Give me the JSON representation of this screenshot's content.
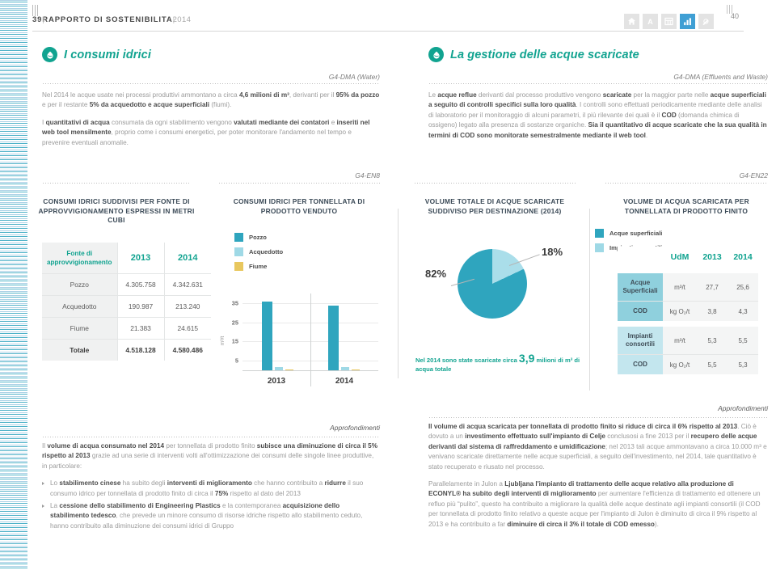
{
  "header": {
    "page_number_left": "39",
    "title": "RAPPORTO DI SOSTENIBILITA",
    "separator": "|",
    "year": "2014",
    "page_number_right": "40",
    "icons": [
      {
        "name": "home-icon",
        "active": false
      },
      {
        "name": "text-icon",
        "active": false
      },
      {
        "name": "table-icon",
        "active": false
      },
      {
        "name": "bar-chart-icon",
        "active": true
      },
      {
        "name": "edit-icon",
        "active": false
      }
    ],
    "active_color": "#3f9fd4"
  },
  "left_section": {
    "icon_name": "water-drop-icon",
    "heading": "I consumi idrici",
    "g4_tag": "G4-DMA (Water)",
    "paragraphs": [
      "Nel 2014 le acque usate nei processi produttivi ammontano a circa <b>4,6 milioni di m³</b>, derivanti per il <b>95% da pozzo</b> e per il restante <b>5% da acquedotto e acque superficiali</b> (fiumi).",
      "I <b>quantitativi di acqua</b> consumata da ogni stabilimento vengono <b>valutati mediante dei contatori</b> e <b>inseriti nel web tool mensilmente</b>, proprio come i consumi energetici, per poter monitorare l'andamento nel tempo e prevenire eventuali anomalie."
    ]
  },
  "right_section": {
    "icon_name": "water-drop-icon",
    "heading": "La gestione delle acque scaricate",
    "g4_tag": "G4-DMA (Effluents and Waste)",
    "paragraphs": [
      "Le <b>acque reflue</b> derivanti dal processo produttivo vengono <b>scaricate</b> per la maggior parte nelle <b>acque superficiali a seguito di controlli specifici sulla loro qualità</b>. I controlli sono effettuati periodicamente mediante delle analisi di laboratorio per il monitoraggio di alcuni parametri, il più rilevante dei quali è il <b>COD</b> (domanda chimica di ossigeno) legato alla presenza di sostanze organiche. <b>Sia il quantitativo di acque scaricate che la sua qualità in termini di COD sono monitorate semestralmente mediante il web tool</b>."
    ]
  },
  "g4_mid_left": "G4-EN8",
  "g4_mid_right": "G4-EN22",
  "fig1": {
    "title": "CONSUMI IDRICI SUDDIVISI PER FONTE DI APPROVVIGIONAMENTO ESPRESSI IN METRI CUBI",
    "table": {
      "header_label": "Fonte di approvvigionamento",
      "columns": [
        "2013",
        "2014"
      ],
      "rows": [
        {
          "label": "Pozzo",
          "values": [
            "4.305.758",
            "4.342.631"
          ]
        },
        {
          "label": "Acquedotto",
          "values": [
            "190.987",
            "213.240"
          ]
        },
        {
          "label": "Fiume",
          "values": [
            "21.383",
            "24.615"
          ]
        }
      ],
      "total": {
        "label": "Totale",
        "values": [
          "4.518.128",
          "4.580.486"
        ]
      }
    }
  },
  "fig2": {
    "title": "CONSUMI IDRICI PER TONNELLATA DI PRODOTTO VENDUTO"
  },
  "fig3": {
    "title": "VOLUME TOTALE DI ACQUE SCARICATE SUDDIVISO PER DESTINAZIONE (2014)",
    "note_prefix": "Nel 2014 sono state scaricate circa",
    "note_big": "3,9",
    "note_suffix": "milioni di m³ di acqua totale"
  },
  "fig4": {
    "title": "VOLUME DI ACQUA SCARICATA PER TONNELLATA DI PRODOTTO FINITO",
    "legend": [
      {
        "label": "Acque superficiali",
        "color": "#2fa5be"
      },
      {
        "label": "Impianti consortili",
        "color": "#9fd9e6"
      }
    ],
    "table": {
      "columns": [
        "UdM",
        "2013",
        "2014"
      ],
      "groups": [
        {
          "name": "Acque Superficiali",
          "shade": "dark",
          "rows": [
            {
              "label": "Acque Superficiali",
              "unit": "m³/t",
              "v2013": "27,7",
              "v2014": "25,6"
            },
            {
              "label": "COD",
              "unit": "kg O₂/t",
              "v2013": "3,8",
              "v2014": "4,3"
            }
          ]
        },
        {
          "name": "Impianti consortili",
          "shade": "light",
          "rows": [
            {
              "label": "Impianti consortili",
              "unit": "m³/t",
              "v2013": "5,3",
              "v2014": "5,5"
            },
            {
              "label": "COD",
              "unit": "kg O₂/t",
              "v2013": "5,5",
              "v2014": "5,3"
            }
          ]
        }
      ]
    }
  },
  "approfondimenti_label": "Approfondimenti",
  "bottom_left": {
    "intro": "Il <b>volume di acqua consumato nel 2014</b> per tonnellata di prodotto finito <b>subisce una diminuzione di circa il 5% rispetto al 2013</b> grazie ad una serie di interventi volti all'ottimizzazione dei consumi delle singole linee produttive, in particolare:",
    "bullets": [
      "Lo <b>stabilimento cinese</b> ha subito degli <b>interventi di miglioramento</b> che hanno contribuito a <b>ridurre</b> il suo consumo idrico per tonnellata di prodotto finito di circa il <b>75%</b> rispetto al dato del 2013",
      "La <b>cessione dello stabilimento di Engineering Plastics</b> e la contemporanea <b>acquisizione dello stabilimento tedesco</b>, che prevede un minore consumo di risorse idriche rispetto allo stabilimento ceduto, hanno contribuito alla diminuzione dei consumi idrici di Gruppo"
    ]
  },
  "bottom_right": {
    "paragraphs": [
      "<b>Il volume di acqua scaricata per tonnellata di prodotto finito si riduce di circa il 6% rispetto al 2013</b>. Ciò è dovuto a un <b>investimento effettuato sull'impianto di Celje</b> conclusosi a fine 2013 per il <b>recupero delle acque derivanti dal sistema di raffreddamento e umidificazione</b>; nel 2013 tali acque ammontavano a circa 10.000 m³ e venivano scaricate direttamente nelle acque superficiali, a seguito dell'investimento, nel 2014, tale quantitativo è stato recuperato e riusato nel processo.",
      "Parallelamente in Julon a <b>Ljubljana l'impianto di trattamento delle acque relativo alla produzione di ECONYL® ha subito degli interventi di miglioramento</b> per aumentare l'efficienza di trattamento ed ottenere un refluo più “pulito”, questo ha contribuito a migliorare la qualità delle acque destinate agli impianti consortili (il COD per tonnellata di prodotto finito relativo a queste acque per l'impianto di Julon è diminuito di circa il 9% rispetto al 2013 e ha contribuito a far <b>diminuire di circa il 3% il totale di COD emesso</b>)."
    ]
  },
  "chart_data": [
    {
      "type": "bar",
      "title": "CONSUMI IDRICI PER TONNELLATA DI PRODOTTO VENDUTO",
      "categories": [
        "2013",
        "2014"
      ],
      "series": [
        {
          "name": "Pozzo",
          "color": "#2fa5be",
          "values": [
            36.0,
            33.5
          ]
        },
        {
          "name": "Acquedotto",
          "color": "#9fd9e6",
          "values": [
            1.6,
            1.8
          ]
        },
        {
          "name": "Fiume",
          "color": "#e8c75e",
          "values": [
            0.5,
            0.5
          ]
        }
      ],
      "ylabel": "m³/t",
      "yticks": [
        5,
        15,
        25,
        35
      ],
      "ylim": [
        0,
        40
      ],
      "grid": true,
      "legend_position": "top-left"
    },
    {
      "type": "pie",
      "title": "VOLUME TOTALE DI ACQUE SCARICATE SUDDIVISO PER DESTINAZIONE (2014)",
      "labels": [
        "Acque superficiali",
        "Impianti consortili"
      ],
      "values": [
        82,
        18
      ],
      "value_labels": [
        "82%",
        "18%"
      ],
      "colors": [
        "#2fa5be",
        "#aadeea"
      ],
      "legend_position": "right"
    },
    {
      "type": "table",
      "title": "VOLUME DI ACQUA SCARICATA PER TONNELLATA DI PRODOTTO FINITO",
      "columns": [
        "",
        "UdM",
        "2013",
        "2014"
      ],
      "rows": [
        [
          "Acque Superficiali",
          "m³/t",
          "27,7",
          "25,6"
        ],
        [
          "COD",
          "kg O₂/t",
          "3,8",
          "4,3"
        ],
        [
          "Impianti consortili",
          "m³/t",
          "5,3",
          "5,5"
        ],
        [
          "COD",
          "kg O₂/t",
          "5,5",
          "5,3"
        ]
      ]
    },
    {
      "type": "table",
      "title": "CONSUMI IDRICI SUDDIVISI PER FONTE DI APPROVVIGIONAMENTO ESPRESSI IN METRI CUBI",
      "columns": [
        "Fonte di approvvigionamento",
        "2013",
        "2014"
      ],
      "rows": [
        [
          "Pozzo",
          "4.305.758",
          "4.342.631"
        ],
        [
          "Acquedotto",
          "190.987",
          "213.240"
        ],
        [
          "Fiume",
          "21.383",
          "24.615"
        ],
        [
          "Totale",
          "4.518.128",
          "4.580.486"
        ]
      ]
    }
  ]
}
